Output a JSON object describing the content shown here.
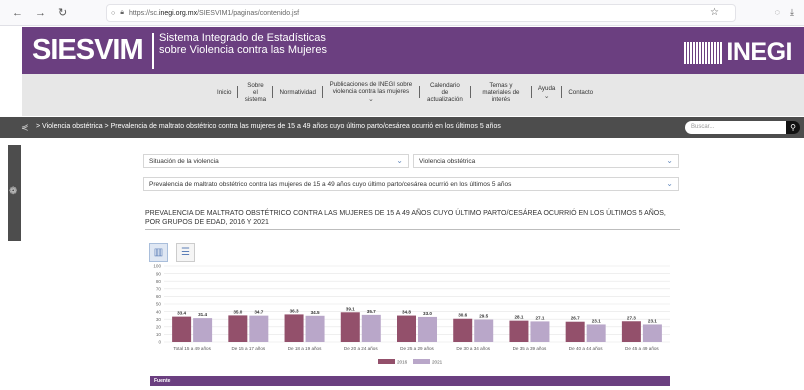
{
  "browser": {
    "url_prefix": "https://sc.",
    "url_host": "inegi.org.mx",
    "url_path": "/SIESVIM1/paginas/contenido.jsf"
  },
  "header": {
    "logo": "SIESVIM",
    "subtitle": "Sistema Integrado de Estadísticas sobre Violencia contra las Mujeres",
    "brand": "INEGI"
  },
  "menu": {
    "items": [
      "Inicio",
      "Sobre el sistema",
      "Normatividad",
      "Publicaciones de INEGI sobre violencia contra las mujeres",
      "Calendario de actualización",
      "Temas y materiales de interés",
      "Ayuda",
      "Contacto"
    ]
  },
  "breadcrumb": {
    "text": "> Violencia obstétrica > Prevalencia de maltrato obstétrico contra las mujeres de 15 a 49 años cuyo último parto/cesárea ocurrió en los últimos 5 años"
  },
  "search": {
    "placeholder": "Buscar..."
  },
  "filters": {
    "situacion": "Situación de la violencia",
    "tipo": "Violencia obstétrica",
    "indicador": "Prevalencia de maltrato obstétrico contra las mujeres de 15 a 49 años cuyo último parto/cesárea ocurrió en los últimos 5 años"
  },
  "page_title": "PREVALENCIA DE MALTRATO OBSTÉTRICO CONTRA LAS MUJERES DE 15 A 49 AÑOS CUYO ÚLTIMO PARTO/CESÁREA OCURRIÓ EN LOS ÚLTIMOS 5 AÑOS, POR GRUPOS DE EDAD, 2016 Y 2021",
  "fuente": {
    "label": "Fuente"
  },
  "chart_data": {
    "type": "bar",
    "categories": [
      "Total 15 a 49 años",
      "De 15 a 17 años",
      "De 18 a 19 años",
      "De 20 a 24 años",
      "De 25 a 29 años",
      "De 30 a 34 años",
      "De 35 a 39 años",
      "De 40 a 44 años",
      "De 45 a 49 años"
    ],
    "series": [
      {
        "name": "2016",
        "color": "#93506b",
        "values": [
          33.4,
          35.0,
          36.3,
          39.1,
          34.8,
          30.6,
          28.1,
          26.7,
          27.3
        ]
      },
      {
        "name": "2021",
        "color": "#b9a7c9",
        "values": [
          31.4,
          34.7,
          34.5,
          35.7,
          33.0,
          29.5,
          27.1,
          23.1,
          23.1
        ]
      }
    ],
    "yticks": [
      0,
      10,
      20,
      30,
      40,
      50,
      60,
      70,
      80,
      90,
      100
    ],
    "ylim": [
      0,
      100
    ],
    "grid": true,
    "legend": "bottom"
  }
}
